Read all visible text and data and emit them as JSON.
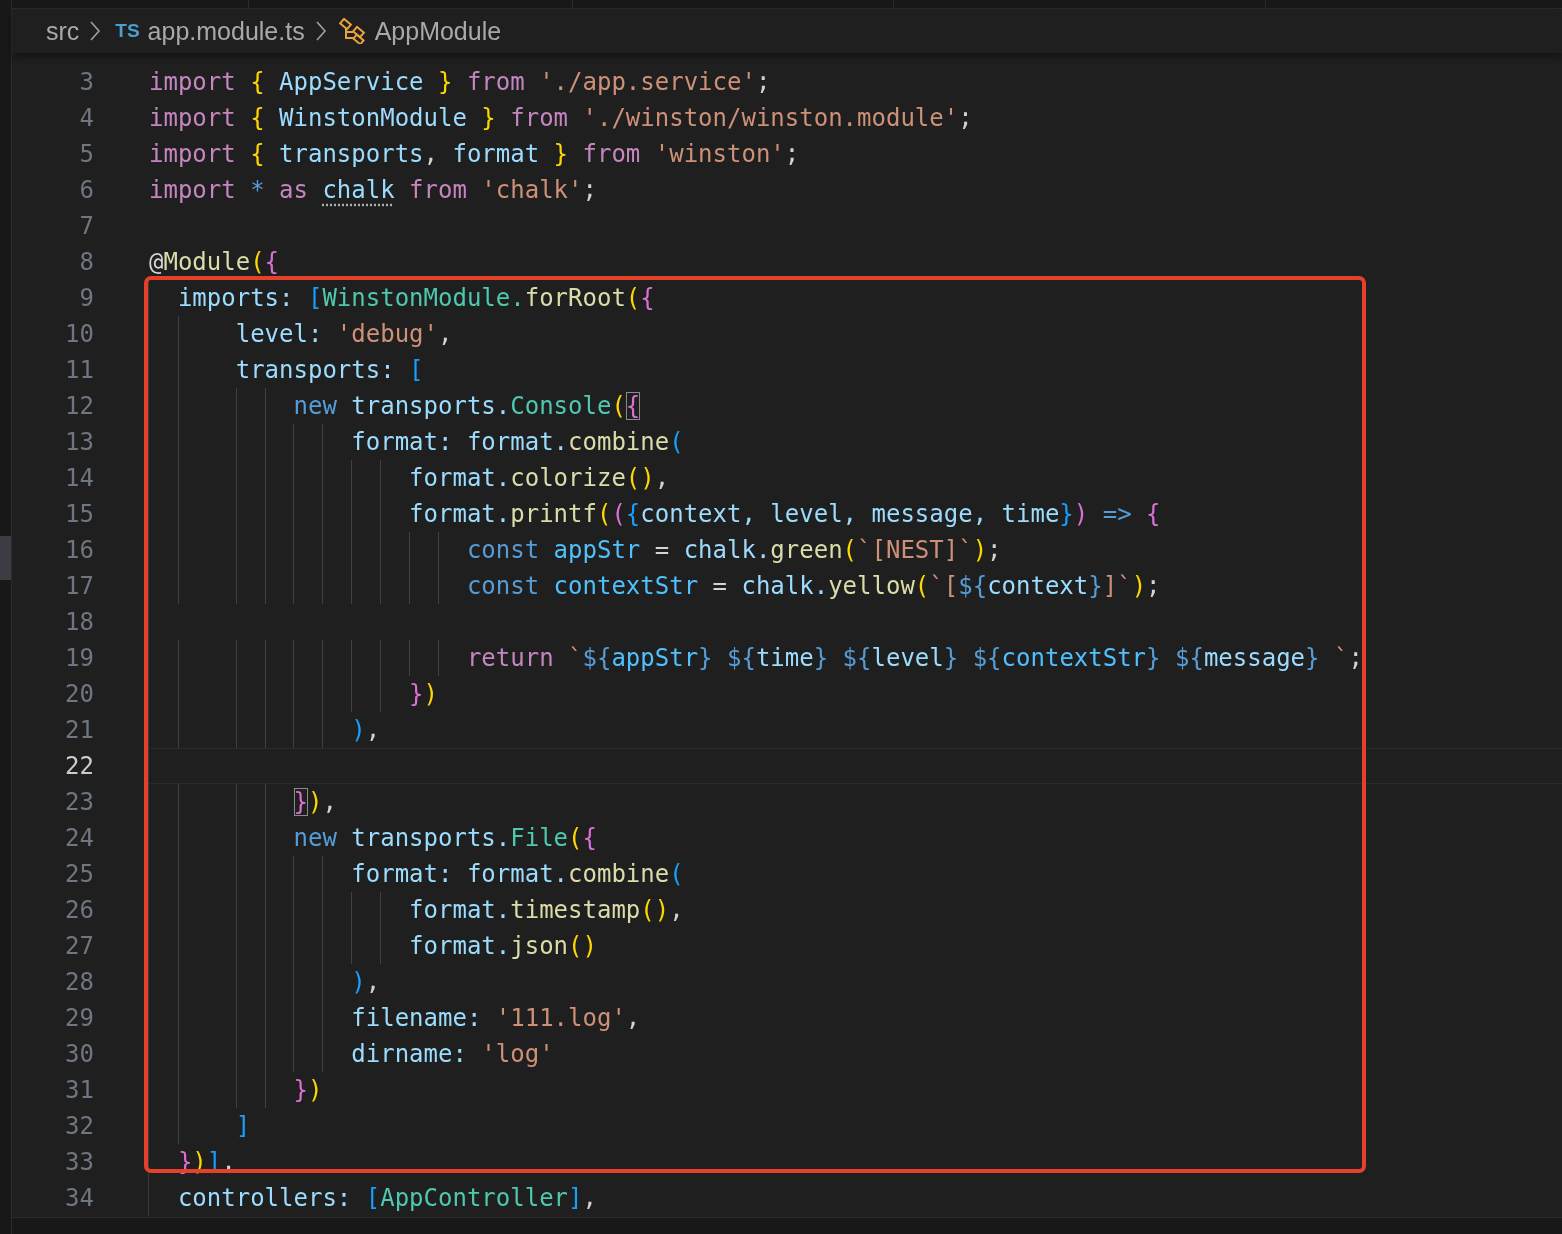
{
  "breadcrumb": [
    {
      "kind": "folder",
      "label": "src"
    },
    {
      "kind": "file",
      "badge": "TS",
      "label": "app.module.ts"
    },
    {
      "kind": "symbol",
      "label": "AppModule"
    }
  ],
  "groups": [
    {
      "kind": "plain",
      "lines": [
        {
          "number": "3",
          "current": false,
          "tokens": [
            {
              "text": "import",
              "kind": "kw"
            },
            {
              "text": " {",
              "kind": "b1"
            },
            {
              "text": " AppService ",
              "kind": "var"
            },
            {
              "text": "}",
              "kind": "b1"
            },
            {
              "text": " from",
              "kind": "kw"
            },
            {
              "text": " './app.service'",
              "kind": "str"
            },
            {
              "text": ";",
              "kind": "p"
            }
          ]
        },
        {
          "number": "4",
          "current": false,
          "tokens": [
            {
              "text": "import",
              "kind": "kw"
            },
            {
              "text": " {",
              "kind": "b1"
            },
            {
              "text": " WinstonModule ",
              "kind": "var"
            },
            {
              "text": "}",
              "kind": "b1"
            },
            {
              "text": " from",
              "kind": "kw"
            },
            {
              "text": " './winston/winston.module'",
              "kind": "str"
            },
            {
              "text": ";",
              "kind": "p"
            }
          ]
        },
        {
          "number": "5",
          "current": false,
          "tokens": [
            {
              "text": "import",
              "kind": "kw"
            },
            {
              "text": " {",
              "kind": "b1"
            },
            {
              "text": " transports",
              "kind": "var"
            },
            {
              "text": ",",
              "kind": "p"
            },
            {
              "text": " format ",
              "kind": "var"
            },
            {
              "text": "}",
              "kind": "b1"
            },
            {
              "text": " from",
              "kind": "kw"
            },
            {
              "text": " 'winston'",
              "kind": "str"
            },
            {
              "text": ";",
              "kind": "p"
            }
          ]
        },
        {
          "number": "6",
          "current": false,
          "tokens": [
            {
              "text": "import",
              "kind": "kw"
            },
            {
              "text": " *",
              "kind": "st"
            },
            {
              "text": " as ",
              "kind": "kw"
            },
            {
              "text": "chalk",
              "kind": "var",
              "hint": true
            },
            {
              "text": " from",
              "kind": "kw"
            },
            {
              "text": " 'chalk'",
              "kind": "str"
            },
            {
              "text": ";",
              "kind": "p"
            }
          ]
        },
        {
          "number": "7",
          "current": false
        },
        {
          "number": "8",
          "current": false,
          "tokens": [
            {
              "text": "@",
              "kind": "p"
            },
            {
              "text": "Module",
              "kind": "fn"
            },
            {
              "text": "(",
              "kind": "b1"
            },
            {
              "text": "{",
              "kind": "b2"
            }
          ]
        }
      ]
    },
    {
      "kind": "highlight",
      "lines": [
        {
          "number": "9",
          "current": false,
          "tokens": [
            {
              "text": "  imports:",
              "kind": "var"
            },
            {
              "text": " [",
              "kind": "b3"
            },
            {
              "text": "WinstonModule.",
              "kind": "type"
            },
            {
              "text": "forRoot",
              "kind": "fn"
            },
            {
              "text": "(",
              "kind": "b1"
            },
            {
              "text": "{",
              "kind": "b2"
            }
          ]
        },
        {
          "number": "10",
          "current": false,
          "tokens": [
            {
              "text": "      level:",
              "kind": "var"
            },
            {
              "text": " 'debug'",
              "kind": "str"
            },
            {
              "text": ",",
              "kind": "p"
            }
          ]
        },
        {
          "number": "11",
          "current": false,
          "tokens": [
            {
              "text": "      transports:",
              "kind": "var"
            },
            {
              "text": " [",
              "kind": "b3"
            }
          ]
        },
        {
          "number": "12",
          "current": false,
          "tokens": [
            {
              "text": "          new",
              "kind": "st"
            },
            {
              "text": " transports.",
              "kind": "var"
            },
            {
              "text": "Console",
              "kind": "type"
            },
            {
              "text": "(",
              "kind": "b1"
            },
            {
              "text": "{",
              "kind": "b2",
              "boxed": true
            }
          ]
        },
        {
          "number": "13",
          "current": false,
          "tokens": [
            {
              "text": "              format:",
              "kind": "var"
            },
            {
              "text": " format.",
              "kind": "var"
            },
            {
              "text": "combine",
              "kind": "fn"
            },
            {
              "text": "(",
              "kind": "b3"
            }
          ]
        },
        {
          "number": "14",
          "current": false,
          "tokens": [
            {
              "text": "                  format.",
              "kind": "var"
            },
            {
              "text": "colorize",
              "kind": "fn"
            },
            {
              "text": "()",
              "kind": "b1"
            },
            {
              "text": ",",
              "kind": "p"
            }
          ]
        },
        {
          "number": "15",
          "current": false,
          "tokens": [
            {
              "text": "                  format.",
              "kind": "var"
            },
            {
              "text": "printf",
              "kind": "fn"
            },
            {
              "text": "(",
              "kind": "b1"
            },
            {
              "text": "(",
              "kind": "b2"
            },
            {
              "text": "{",
              "kind": "b3"
            },
            {
              "text": "context,",
              "kind": "var"
            },
            {
              "text": " level,",
              "kind": "var"
            },
            {
              "text": " message,",
              "kind": "var"
            },
            {
              "text": " time",
              "kind": "var"
            },
            {
              "text": "}",
              "kind": "b3"
            },
            {
              "text": ")",
              "kind": "b2"
            },
            {
              "text": " =>",
              "kind": "st"
            },
            {
              "text": " {",
              "kind": "b2"
            }
          ]
        },
        {
          "number": "16",
          "current": false,
          "tokens": [
            {
              "text": "                      const",
              "kind": "st"
            },
            {
              "text": " appStr",
              "kind": "cst"
            },
            {
              "text": " =",
              "kind": "p"
            },
            {
              "text": " chalk.",
              "kind": "var"
            },
            {
              "text": "green",
              "kind": "fn"
            },
            {
              "text": "(",
              "kind": "b1"
            },
            {
              "text": "`[NEST]`",
              "kind": "str"
            },
            {
              "text": ")",
              "kind": "b1"
            },
            {
              "text": ";",
              "kind": "p"
            }
          ]
        },
        {
          "number": "17",
          "current": false,
          "tokens": [
            {
              "text": "                      const",
              "kind": "st"
            },
            {
              "text": " contextStr",
              "kind": "cst"
            },
            {
              "text": " =",
              "kind": "p"
            },
            {
              "text": " chalk.",
              "kind": "var"
            },
            {
              "text": "yellow",
              "kind": "fn"
            },
            {
              "text": "(",
              "kind": "b1"
            },
            {
              "text": "`[",
              "kind": "str"
            },
            {
              "text": "${",
              "kind": "st"
            },
            {
              "text": "context",
              "kind": "var"
            },
            {
              "text": "}",
              "kind": "st"
            },
            {
              "text": "]`",
              "kind": "str"
            },
            {
              "text": ")",
              "kind": "b1"
            },
            {
              "text": ";",
              "kind": "p"
            }
          ]
        },
        {
          "number": "18",
          "current": false
        },
        {
          "number": "19",
          "current": false,
          "tokens": [
            {
              "text": "                      return",
              "kind": "kw"
            },
            {
              "text": " `",
              "kind": "str"
            },
            {
              "text": "${",
              "kind": "st"
            },
            {
              "text": "appStr",
              "kind": "cst"
            },
            {
              "text": "}",
              "kind": "st"
            },
            {
              "text": " ${",
              "kind": "st"
            },
            {
              "text": "time",
              "kind": "var"
            },
            {
              "text": "}",
              "kind": "st"
            },
            {
              "text": " ${",
              "kind": "st"
            },
            {
              "text": "level",
              "kind": "var"
            },
            {
              "text": "}",
              "kind": "st"
            },
            {
              "text": " ${",
              "kind": "st"
            },
            {
              "text": "contextStr",
              "kind": "cst"
            },
            {
              "text": "}",
              "kind": "st"
            },
            {
              "text": " ${",
              "kind": "st"
            },
            {
              "text": "message",
              "kind": "var"
            },
            {
              "text": "}",
              "kind": "st"
            },
            {
              "text": " `",
              "kind": "str"
            },
            {
              "text": ";",
              "kind": "p"
            }
          ]
        },
        {
          "number": "20",
          "current": false,
          "tokens": [
            {
              "text": "                  }",
              "kind": "b2"
            },
            {
              "text": ")",
              "kind": "b1"
            }
          ]
        },
        {
          "number": "21",
          "current": false,
          "tokens": [
            {
              "text": "              )",
              "kind": "b3"
            },
            {
              "text": ",",
              "kind": "p"
            }
          ]
        },
        {
          "number": "22",
          "current": true
        },
        {
          "number": "23",
          "current": false,
          "tokens": [
            {
              "text": "          }",
              "kind": "b2",
              "boxed": true
            },
            {
              "text": ")",
              "kind": "b1"
            },
            {
              "text": ",",
              "kind": "p"
            }
          ]
        },
        {
          "number": "24",
          "current": false,
          "tokens": [
            {
              "text": "          new",
              "kind": "st"
            },
            {
              "text": " transports.",
              "kind": "var"
            },
            {
              "text": "File",
              "kind": "type"
            },
            {
              "text": "(",
              "kind": "b1"
            },
            {
              "text": "{",
              "kind": "b2"
            }
          ]
        },
        {
          "number": "25",
          "current": false,
          "tokens": [
            {
              "text": "              format:",
              "kind": "var"
            },
            {
              "text": " format.",
              "kind": "var"
            },
            {
              "text": "combine",
              "kind": "fn"
            },
            {
              "text": "(",
              "kind": "b3"
            }
          ]
        },
        {
          "number": "26",
          "current": false,
          "tokens": [
            {
              "text": "                  format.",
              "kind": "var"
            },
            {
              "text": "timestamp",
              "kind": "fn"
            },
            {
              "text": "()",
              "kind": "b1"
            },
            {
              "text": ",",
              "kind": "p"
            }
          ]
        },
        {
          "number": "27",
          "current": false,
          "tokens": [
            {
              "text": "                  format.",
              "kind": "var"
            },
            {
              "text": "json",
              "kind": "fn"
            },
            {
              "text": "()",
              "kind": "b1"
            }
          ]
        },
        {
          "number": "28",
          "current": false,
          "tokens": [
            {
              "text": "              )",
              "kind": "b3"
            },
            {
              "text": ",",
              "kind": "p"
            }
          ]
        },
        {
          "number": "29",
          "current": false,
          "tokens": [
            {
              "text": "              filename:",
              "kind": "var"
            },
            {
              "text": " '111.log'",
              "kind": "str"
            },
            {
              "text": ",",
              "kind": "p"
            }
          ]
        },
        {
          "number": "30",
          "current": false,
          "tokens": [
            {
              "text": "              dirname:",
              "kind": "var"
            },
            {
              "text": " 'log'",
              "kind": "str"
            }
          ]
        },
        {
          "number": "31",
          "current": false,
          "tokens": [
            {
              "text": "          }",
              "kind": "b2"
            },
            {
              "text": ")",
              "kind": "b1"
            }
          ]
        },
        {
          "number": "32",
          "current": false,
          "tokens": [
            {
              "text": "      ]",
              "kind": "b3"
            }
          ]
        },
        {
          "number": "33",
          "current": false,
          "tokens": [
            {
              "text": "  }",
              "kind": "b2"
            },
            {
              "text": ")",
              "kind": "b1"
            },
            {
              "text": "]",
              "kind": "b3"
            },
            {
              "text": ",",
              "kind": "p"
            }
          ]
        }
      ]
    },
    {
      "kind": "plain",
      "lines": [
        {
          "number": "34",
          "current": false,
          "tokens": [
            {
              "text": "  controllers:",
              "kind": "var"
            },
            {
              "text": " [",
              "kind": "b3"
            },
            {
              "text": "AppController",
              "kind": "type"
            },
            {
              "text": "]",
              "kind": "b3"
            },
            {
              "text": ",",
              "kind": "p"
            }
          ]
        }
      ]
    }
  ]
}
